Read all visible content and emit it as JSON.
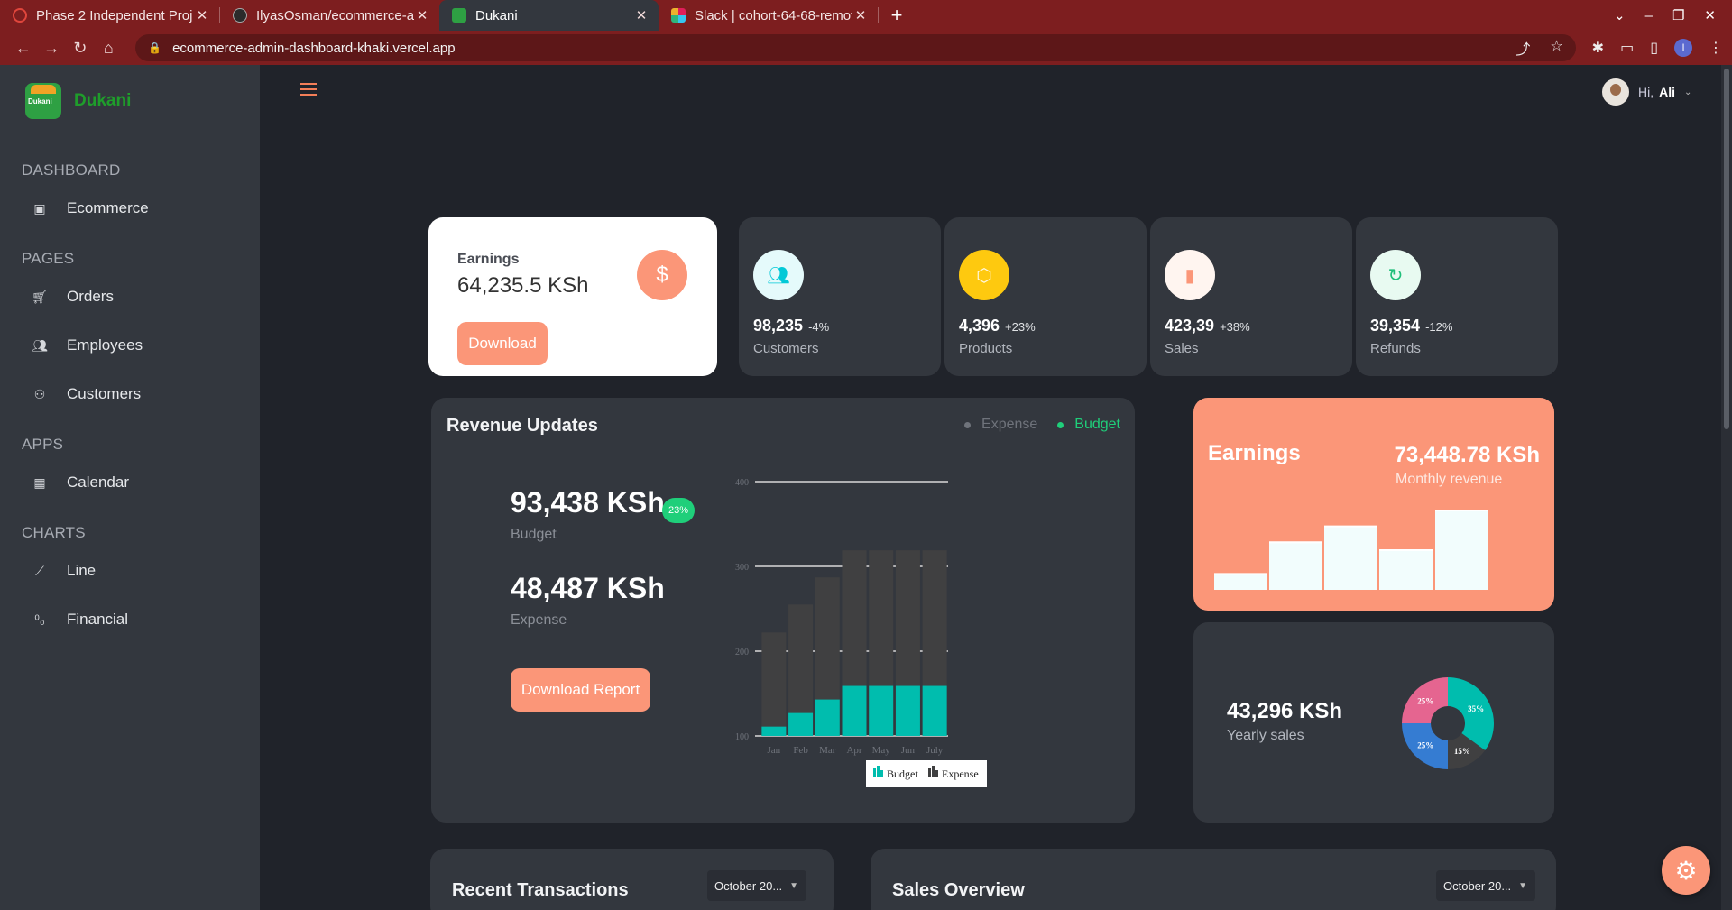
{
  "browser": {
    "tabs": [
      {
        "title": "Phase 2 Independent Proj",
        "favicon_color": "#e0463c"
      },
      {
        "title": "IlyasOsman/ecommerce-a",
        "favicon_color": "#2b2b2b"
      },
      {
        "title": "Dukani",
        "favicon_color": "#2ea043",
        "active": true
      },
      {
        "title": "Slack | cohort-64-68-remot",
        "favicon_color": "#e3a23a"
      }
    ],
    "url": "ecommerce-admin-dashboard-khaki.vercel.app",
    "profile_initial": "I"
  },
  "sidebar": {
    "brand": "Dukani",
    "sections": [
      {
        "title": "DASHBOARD",
        "items": [
          {
            "label": "Ecommerce",
            "icon": "shopping-bag-icon"
          }
        ]
      },
      {
        "title": "PAGES",
        "items": [
          {
            "label": "Orders",
            "icon": "cart-icon"
          },
          {
            "label": "Employees",
            "icon": "users-icon"
          },
          {
            "label": "Customers",
            "icon": "customer-icon"
          }
        ]
      },
      {
        "title": "APPS",
        "items": [
          {
            "label": "Calendar",
            "icon": "calendar-icon"
          }
        ]
      },
      {
        "title": "CHARTS",
        "items": [
          {
            "label": "Line",
            "icon": "line-chart-icon"
          },
          {
            "label": "Financial",
            "icon": "financial-icon"
          }
        ]
      }
    ]
  },
  "header": {
    "greeting": "Hi,",
    "user": "Ali"
  },
  "earnings_card": {
    "label": "Earnings",
    "value": "64,235.5 KSh",
    "button": "Download",
    "icon": "$"
  },
  "stats": [
    {
      "value": "98,235",
      "pct": "-4%",
      "label": "Customers",
      "icon": "customers-icon",
      "bg": "#e5fafb",
      "fg": "#03c9d7"
    },
    {
      "value": "4,396",
      "pct": "+23%",
      "label": "Products",
      "icon": "box-icon",
      "bg": "#fec90f",
      "fg": "#fff8e1"
    },
    {
      "value": "423,39",
      "pct": "+38%",
      "label": "Sales",
      "icon": "bar-chart-icon",
      "bg": "#fff5f0",
      "fg": "#fb9678"
    },
    {
      "value": "39,354",
      "pct": "-12%",
      "label": "Refunds",
      "icon": "refresh-icon",
      "bg": "#e8faf1",
      "fg": "#1fbf7a"
    }
  ],
  "revenue": {
    "title": "Revenue Updates",
    "legend": [
      {
        "label": "Expense",
        "color": "#5b5f66"
      },
      {
        "label": "Budget",
        "color": "#1fcf7a"
      }
    ],
    "budget_value": "93,438 KSh",
    "budget_badge": "23%",
    "budget_label": "Budget",
    "expense_value": "48,487 KSh",
    "expense_label": "Expense",
    "button": "Download Report"
  },
  "chart_data": [
    {
      "type": "bar",
      "stacked": true,
      "categories": [
        "Jan",
        "Feb",
        "Mar",
        "Apr",
        "May",
        "Jun",
        "July"
      ],
      "series": [
        {
          "name": "Budget",
          "values": [
            111,
            127,
            143,
            159,
            159,
            159,
            159
          ],
          "color": "#00bdae"
        },
        {
          "name": "Expense",
          "values": [
            222,
            255,
            287,
            319,
            319,
            319,
            319
          ],
          "color": "#404041"
        }
      ],
      "yticks": [
        100,
        200,
        300,
        400
      ],
      "ylim": [
        100,
        400
      ],
      "legend": [
        "Budget",
        "Expense"
      ],
      "legend_position": "bottom"
    },
    {
      "type": "bar",
      "values": [
        2,
        6,
        8,
        5,
        10
      ],
      "color": "#f2fdfd"
    },
    {
      "type": "pie",
      "donut": true,
      "slices": [
        {
          "label": "35%",
          "value": 35,
          "color": "#00bdae"
        },
        {
          "label": "15%",
          "value": 15,
          "color": "#404041"
        },
        {
          "label": "25%",
          "value": 25,
          "color": "#357cd2"
        },
        {
          "label": "25%",
          "value": 25,
          "color": "#e56590"
        }
      ]
    }
  ],
  "earnings_panel": {
    "title": "Earnings",
    "amount": "73,448.78 KSh",
    "subtitle": "Monthly revenue"
  },
  "yearly": {
    "amount": "43,296 KSh",
    "subtitle": "Yearly sales"
  },
  "recent": {
    "title": "Recent Transactions",
    "month": "October 20..."
  },
  "sales_overview": {
    "title": "Sales Overview",
    "month": "October 20..."
  }
}
